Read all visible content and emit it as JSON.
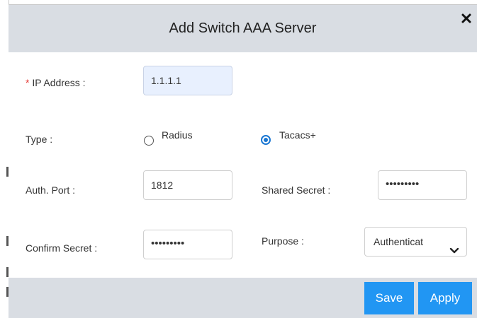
{
  "dialog": {
    "title": "Add Switch AAA Server",
    "close_glyph": "✕"
  },
  "form": {
    "ip_address": {
      "required_mark": "*",
      "label": "IP Address :",
      "value": "1.1.1.1"
    },
    "type": {
      "label": "Type :",
      "options": [
        "Radius",
        "Tacacs+"
      ],
      "selected": "Tacacs+"
    },
    "auth_port": {
      "label": "Auth. Port :",
      "value": "1812"
    },
    "shared_secret": {
      "label": "Shared Secret :",
      "value": "•••••••••"
    },
    "confirm_secret": {
      "label": "Confirm Secret :",
      "value": "•••••••••"
    },
    "purpose": {
      "label": "Purpose :",
      "selected": "Authenticat",
      "icon": "chevron-down-icon"
    }
  },
  "footer": {
    "save_label": "Save",
    "apply_label": "Apply"
  },
  "colors": {
    "header_bg": "#d9dde3",
    "button_bg": "#2196f3",
    "required": "#e53935",
    "radio_checked": "#1976d2",
    "ip_input_bg": "#e8f0fe"
  }
}
